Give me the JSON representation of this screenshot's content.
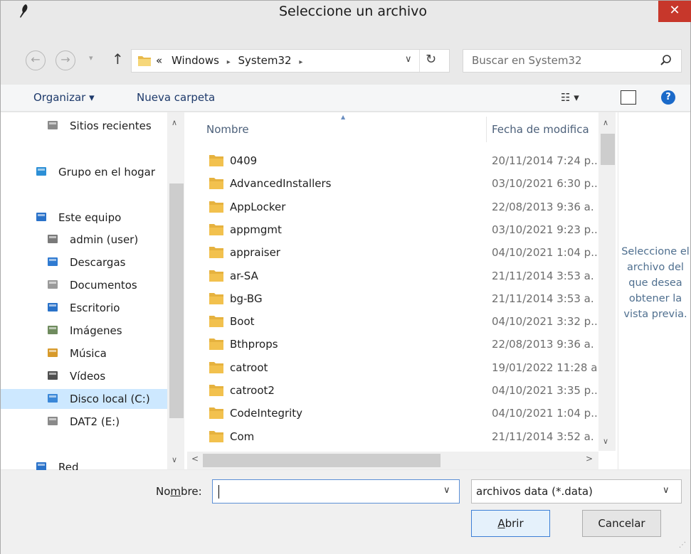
{
  "window": {
    "title": "Seleccione un archivo",
    "close_glyph": "✕"
  },
  "nav": {
    "back_glyph": "←",
    "forward_glyph": "→",
    "recent_glyph": "▾",
    "up_glyph": "↑",
    "address": {
      "prefix": "«",
      "segments": [
        "Windows",
        "System32"
      ],
      "separator": "▸",
      "dropdown_glyph": "∨",
      "refresh_glyph": "↻"
    },
    "search_placeholder": "Buscar en System32"
  },
  "toolbar": {
    "organize_label": "Organizar ▾",
    "new_folder_label": "Nueva carpeta",
    "view_glyph": "☷ ▾",
    "help_glyph": "?"
  },
  "sidebar": {
    "items": [
      {
        "label": "Sitios recientes",
        "icon": "recent-places-icon",
        "indent": 1
      },
      {
        "label": "Grupo en el hogar",
        "icon": "homegroup-icon",
        "indent": 0
      },
      {
        "label": "Este equipo",
        "icon": "computer-icon",
        "indent": 0
      },
      {
        "label": "admin (user)",
        "icon": "user-folder-icon",
        "indent": 1
      },
      {
        "label": "Descargas",
        "icon": "downloads-icon",
        "indent": 1
      },
      {
        "label": "Documentos",
        "icon": "documents-icon",
        "indent": 1
      },
      {
        "label": "Escritorio",
        "icon": "desktop-icon",
        "indent": 1
      },
      {
        "label": "Imágenes",
        "icon": "pictures-icon",
        "indent": 1
      },
      {
        "label": "Música",
        "icon": "music-icon",
        "indent": 1
      },
      {
        "label": "Vídeos",
        "icon": "videos-icon",
        "indent": 1
      },
      {
        "label": "Disco local (C:)",
        "icon": "local-disk-icon",
        "indent": 1,
        "selected": true
      },
      {
        "label": "DAT2 (E:)",
        "icon": "drive-icon",
        "indent": 1
      },
      {
        "label": "Red",
        "icon": "network-icon",
        "indent": 0
      }
    ]
  },
  "files": {
    "columns": {
      "name": "Nombre",
      "date": "Fecha de modifica"
    },
    "rows": [
      {
        "name": "0409",
        "date": "20/11/2014 7:24 p.."
      },
      {
        "name": "AdvancedInstallers",
        "date": "03/10/2021 6:30 p.."
      },
      {
        "name": "AppLocker",
        "date": "22/08/2013 9:36 a."
      },
      {
        "name": "appmgmt",
        "date": "03/10/2021 9:23 p.."
      },
      {
        "name": "appraiser",
        "date": "04/10/2021 1:04 p.."
      },
      {
        "name": "ar-SA",
        "date": "21/11/2014 3:53 a."
      },
      {
        "name": "bg-BG",
        "date": "21/11/2014 3:53 a."
      },
      {
        "name": "Boot",
        "date": "04/10/2021 3:32 p.."
      },
      {
        "name": "Bthprops",
        "date": "22/08/2013 9:36 a."
      },
      {
        "name": "catroot",
        "date": "19/01/2022 11:28 a"
      },
      {
        "name": "catroot2",
        "date": "04/10/2021 3:35 p.."
      },
      {
        "name": "CodeIntegrity",
        "date": "04/10/2021 1:04 p.."
      },
      {
        "name": "Com",
        "date": "21/11/2014 3:52 a."
      }
    ]
  },
  "preview": {
    "message": "Seleccione el archivo del que desea obtener la vista previa."
  },
  "footer": {
    "name_label_pre": "No",
    "name_label_accel": "m",
    "name_label_post": "bre:",
    "name_value": "",
    "filter_value": "archivos data (*.data)",
    "open_label_accel": "A",
    "open_label_rest": "brir",
    "cancel_label": "Cancelar"
  },
  "colors": {
    "folder": "#f2c14e",
    "selected_bg": "#cde8ff",
    "accent": "#3c7fd6",
    "close_red": "#c7372b"
  }
}
